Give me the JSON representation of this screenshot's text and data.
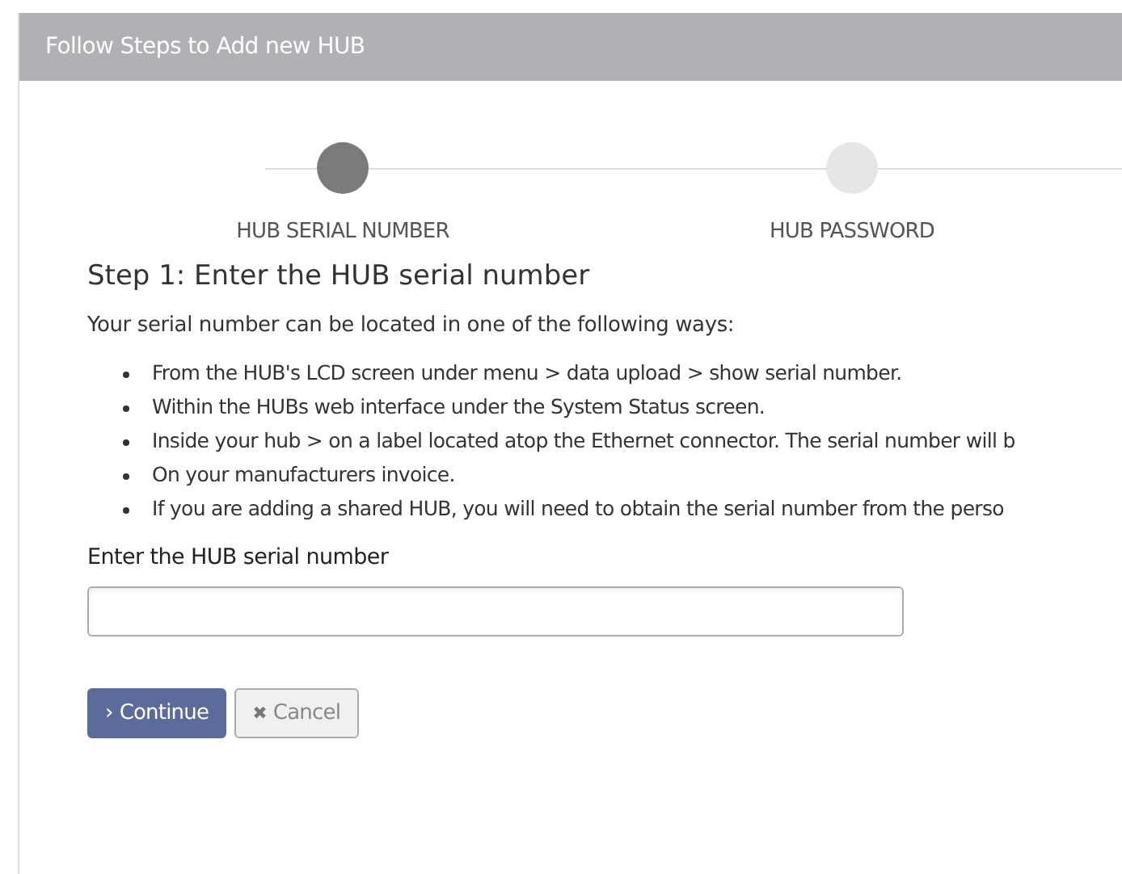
{
  "panel": {
    "title": "Follow Steps to Add new HUB"
  },
  "steps": [
    {
      "label": "HUB SERIAL NUMBER",
      "selected": true
    },
    {
      "label": "HUB PASSWORD",
      "selected": false
    }
  ],
  "heading": "Step 1: Enter the HUB serial number",
  "intro": "Your serial number can be located in one of the following ways:",
  "ways": [
    "From the HUB's LCD screen under menu > data upload > show serial number.",
    "Within the HUBs web interface under the System Status screen.",
    "Inside your hub > on a label located atop the Ethernet connector. The serial number will b",
    "On your manufacturers invoice.",
    "If you are adding a shared HUB, you will need to obtain the serial number from the perso"
  ],
  "field": {
    "label": "Enter the HUB serial number"
  },
  "buttons": [
    {
      "kind": "primary",
      "icon": "›",
      "label": "Continue"
    },
    {
      "kind": "secondary",
      "icon": "✖",
      "label": "Cancel"
    }
  ]
}
